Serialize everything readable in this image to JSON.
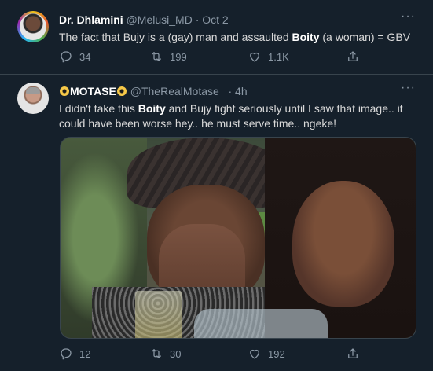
{
  "tweets": [
    {
      "display_name": "Dr. Dhlamini",
      "handle": "@Melusi_MD",
      "separator": "·",
      "time": "Oct 2",
      "more_label": "···",
      "text_1": "The fact that Bujy is a (gay) man and assaulted ",
      "text_bold_1": "Boity",
      "text_2": " (a woman) = GBV",
      "replies": "34",
      "retweets": "199",
      "likes": "1.1K"
    },
    {
      "display_name": "MOTASE",
      "handle": "@TheRealMotase_",
      "separator": "·",
      "time": "4h",
      "more_label": "···",
      "text_1": "I didn't take this ",
      "text_bold_1": "Boity",
      "text_2": " and Bujy fight seriously until I saw that image.. it could have been worse hey.. he must serve time.. ngeke!",
      "replies": "12",
      "retweets": "30",
      "likes": "192"
    }
  ],
  "icons": [
    "reply-icon",
    "retweet-icon",
    "like-icon",
    "share-icon",
    "more-icon",
    "sun-emoji-icon"
  ]
}
